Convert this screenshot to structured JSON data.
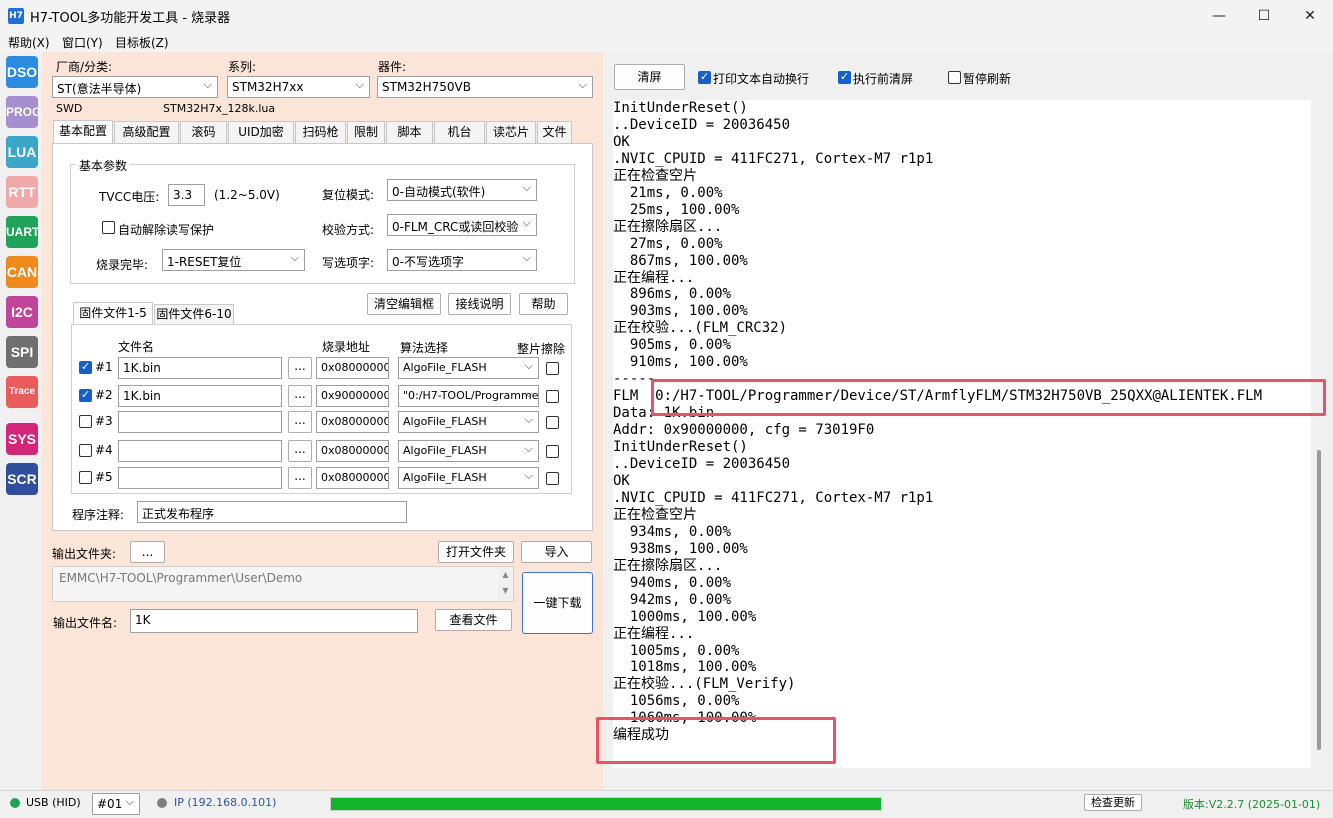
{
  "window": {
    "app_icon": "H7",
    "title": "H7-TOOL多功能开发工具 - 烧录器",
    "minimize": "—",
    "maximize": "☐",
    "close": "✕"
  },
  "menu": [
    "帮助(X)",
    "窗口(Y)",
    "目标板(Z)"
  ],
  "sidebar": [
    {
      "label": "DSO",
      "color": "#2a8be0"
    },
    {
      "label": "PROG",
      "color": "#a58fd0"
    },
    {
      "label": "LUA",
      "color": "#3aa6c8"
    },
    {
      "label": "RTT",
      "color": "#f0a8a8"
    },
    {
      "label": "UART",
      "color": "#1fa35a"
    },
    {
      "label": "CAN",
      "color": "#f08a1c"
    },
    {
      "label": "I2C",
      "color": "#c0449a"
    },
    {
      "label": "SPI",
      "color": "#6f6f6f"
    },
    {
      "label": "Trace",
      "color": "#ea5b5b"
    },
    {
      "label": "SYS",
      "color": "#d4257a"
    },
    {
      "label": "SCR",
      "color": "#2f4f9c"
    }
  ],
  "left": {
    "vendor_label": "厂商/分类:",
    "vendor_value": "ST(意法半导体)",
    "series_label": "系列:",
    "series_value": "STM32H7xx",
    "device_label": "器件:",
    "device_value": "STM32H750VB",
    "interface": "SWD",
    "lua_file": "STM32H7x_128k.lua",
    "tabs": [
      "基本配置",
      "高级配置",
      "滚码",
      "UID加密",
      "扫码枪",
      "限制",
      "脚本",
      "机台",
      "读芯片",
      "文件"
    ],
    "basic_group": "基本参数",
    "tvcc_label": "TVCC电压:",
    "tvcc_value": "3.3",
    "tvcc_range": "(1.2~5.0V)",
    "reset_label": "复位模式:",
    "reset_value": "0-自动模式(软件)",
    "auto_unprotect": "自动解除读写保护",
    "verify_label": "校验方式:",
    "verify_value": "0-FLM_CRC或读回校验",
    "after_label": "烧录完毕:",
    "after_value": "1-RESET复位",
    "option_label": "写选项字:",
    "option_value": "0-不写选项字",
    "btn_clear_editor": "清空编辑框",
    "btn_wiring": "接线说明",
    "btn_help": "帮助",
    "fw_tabs": [
      "固件文件1-5",
      "固件文件6-10"
    ],
    "col_file": "文件名",
    "col_addr": "烧录地址",
    "col_algo": "算法选择",
    "col_erase": "整片擦除",
    "browse": "...",
    "fw_rows": [
      {
        "id": "#1",
        "checked": true,
        "file": "1K.bin",
        "addr": "0x08000000",
        "algo": "AlgoFile_FLASH"
      },
      {
        "id": "#2",
        "checked": true,
        "file": "1K.bin",
        "addr": "0x90000000",
        "algo": "\"0:/H7-TOOL/Programme"
      },
      {
        "id": "#3",
        "checked": false,
        "file": "",
        "addr": "0x08000000",
        "algo": "AlgoFile_FLASH"
      },
      {
        "id": "#4",
        "checked": false,
        "file": "",
        "addr": "0x08000000",
        "algo": "AlgoFile_FLASH"
      },
      {
        "id": "#5",
        "checked": false,
        "file": "",
        "addr": "0x08000000",
        "algo": "AlgoFile_FLASH"
      }
    ],
    "note_label": "程序注释:",
    "note_value": "正式发布程序",
    "out_folder_label": "输出文件夹:",
    "out_folder_browse": "...",
    "btn_open_folder": "打开文件夹",
    "btn_import": "导入",
    "out_path": "EMMC\\H7-TOOL\\Programmer\\User\\Demo",
    "btn_download": "一键下载",
    "out_name_label": "输出文件名:",
    "out_name_value": "1K",
    "btn_view_file": "查看文件"
  },
  "right": {
    "btn_clear": "清屏",
    "chk_wrap": "打印文本自动换行",
    "chk_clear_before": "执行前清屏",
    "chk_pause": "暂停刷新",
    "console_lines": [
      "InitUnderReset()",
      "..DeviceID = 20036450",
      "OK",
      ".NVIC_CPUID = 411FC271, Cortex-M7 r1p1",
      "正在检查空片",
      "  21ms, 0.00%",
      "  25ms, 100.00%",
      "正在擦除扇区...",
      "  27ms, 0.00%",
      "  867ms, 100.00%",
      "正在编程...",
      "  896ms, 0.00%",
      "  903ms, 100.00%",
      "正在校验...(FLM_CRC32)",
      "  905ms, 0.00%",
      "  910ms, 100.00%",
      "-----",
      "FLM  0:/H7-TOOL/Programmer/Device/ST/ArmflyFLM/STM32H750VB_25QXX@ALIENTEK.FLM",
      "Data: 1K.bin",
      "Addr: 0x90000000, cfg = 73019F0",
      "InitUnderReset()",
      "..DeviceID = 20036450",
      "OK",
      ".NVIC_CPUID = 411FC271, Cortex-M7 r1p1",
      "正在检查空片",
      "  934ms, 0.00%",
      "  938ms, 100.00%",
      "正在擦除扇区...",
      "  940ms, 0.00%",
      "  942ms, 0.00%",
      "  1000ms, 100.00%",
      "正在编程...",
      "  1005ms, 0.00%",
      "  1018ms, 100.00%",
      "正在校验...(FLM_Verify)",
      "  1056ms, 0.00%",
      "  1060ms, 100.00%",
      "编程成功"
    ]
  },
  "status": {
    "usb": "USB (HID)",
    "device_index": "#01",
    "ip": "IP (192.168.0.101)",
    "progress": 1.0,
    "btn_update": "检查更新",
    "version": "版本:V2.2.7 (2025-01-01)",
    "usb_color": "#1fa35a",
    "ip_color": "#808080",
    "progress_color": "#12b52a"
  }
}
